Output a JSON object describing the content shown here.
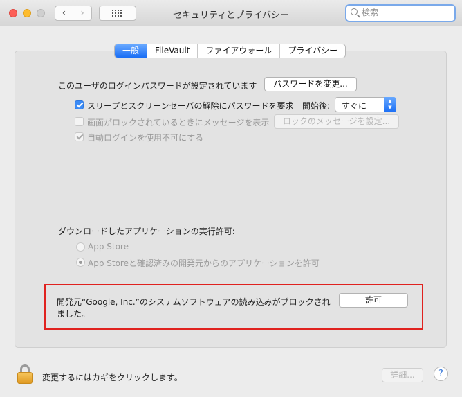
{
  "window": {
    "title": "セキュリティとプライバシー",
    "search_placeholder": "検索"
  },
  "tabs": [
    {
      "label": "一般",
      "active": true
    },
    {
      "label": "FileVault",
      "active": false
    },
    {
      "label": "ファイアウォール",
      "active": false
    },
    {
      "label": "プライバシー",
      "active": false
    }
  ],
  "general": {
    "password_set_text": "このユーザのログインパスワードが設定されています",
    "change_password_button": "パスワードを変更...",
    "require_password_label": "スリープとスクリーンセーバの解除にパスワードを要求",
    "require_password_checked": true,
    "after_label": "開始後:",
    "after_value": "すぐに",
    "show_message_label": "画面がロックされているときにメッセージを表示",
    "show_message_checked": false,
    "set_lock_message_button": "ロックのメッセージを設定...",
    "disable_autologin_label": "自動ログインを使用不可にする",
    "disable_autologin_checked": true
  },
  "downloads": {
    "heading": "ダウンロードしたアプリケーションの実行許可:",
    "option_app_store": "App Store",
    "option_app_store_identified": "App Storeと確認済みの開発元からのアプリケーションを許可",
    "selected": "App Storeと確認済みの開発元からのアプリケーションを許可"
  },
  "alert": {
    "line1": "開発元“Google, Inc.”のシステムソフトウェアの読み込みがブロックされ",
    "line2": "ました。",
    "allow_button": "許可"
  },
  "footer": {
    "lock_text": "変更するにはカギをクリックします。",
    "advanced_button": "詳細...",
    "help_label": "?"
  },
  "colors": {
    "accent": "#1a6ef5",
    "alert_border": "#e0221f",
    "lock": "#e09a22"
  }
}
